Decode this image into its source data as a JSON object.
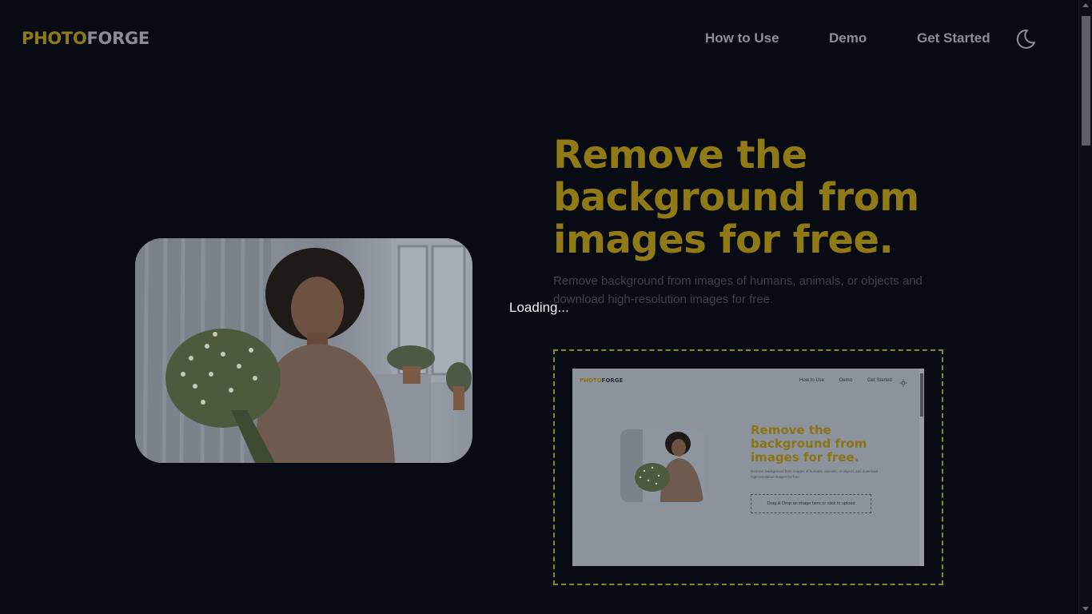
{
  "brand": {
    "part1": "PHOTO",
    "part2": "FORGE"
  },
  "nav": {
    "how_to_use": "How to Use",
    "demo": "Demo",
    "get_started": "Get Started",
    "theme_icon": "moon-icon"
  },
  "hero": {
    "title": "Remove the background from images for free.",
    "subtitle": "Remove background from images of humans, animals, or objects and download high-resolution images for free."
  },
  "overlay": {
    "loading_text": "Loading..."
  },
  "preview": {
    "brand_part1": "PHOTO",
    "brand_part2": "FORGE",
    "nav_how_to_use": "How to Use",
    "nav_demo": "Demo",
    "nav_get_started": "Get Started",
    "theme_icon": "sun-icon",
    "title": "Remove the background from images for free.",
    "subtitle": "Remove background from images of humans, animals, or objects and download high-resolution images for free.",
    "drop_text": "Drag & Drop an image here or click to upload"
  },
  "colors": {
    "background": "#080b13",
    "accent": "#8f7a16",
    "dropzone_border": "#8b8a22",
    "preview_bg": "#8d939d"
  }
}
